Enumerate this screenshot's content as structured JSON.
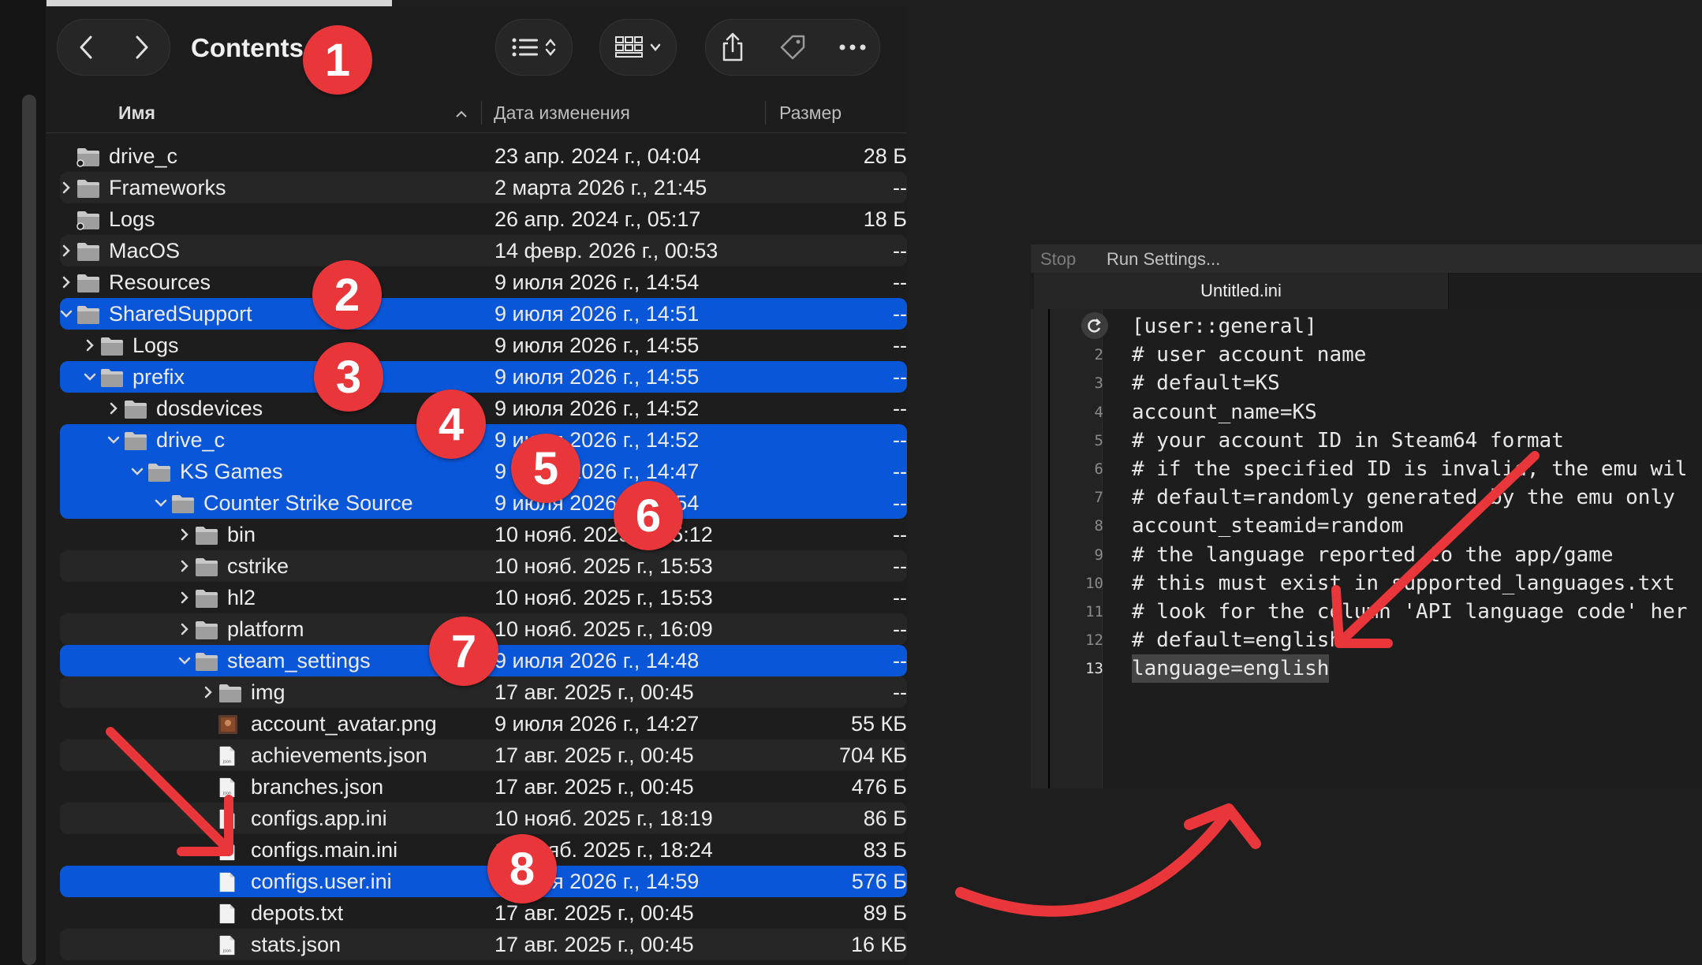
{
  "finder": {
    "title": "Contents",
    "columns": {
      "name": "Имя",
      "date": "Дата изменения",
      "size": "Размер"
    },
    "rows": [
      {
        "name": "drive_c",
        "date": "23 апр. 2024 г., 04:04",
        "size": "28 Б",
        "kind": "alias-folder",
        "depth": 0,
        "disclosure": "none",
        "selected": false
      },
      {
        "name": "Frameworks",
        "date": "2 марта 2026 г., 21:45",
        "size": "--",
        "kind": "folder",
        "depth": 0,
        "disclosure": "closed",
        "selected": false
      },
      {
        "name": "Logs",
        "date": "26 апр. 2024 г., 05:17",
        "size": "18 Б",
        "kind": "alias-folder",
        "depth": 0,
        "disclosure": "none",
        "selected": false
      },
      {
        "name": "MacOS",
        "date": "14 февр. 2026 г., 00:53",
        "size": "--",
        "kind": "folder",
        "depth": 0,
        "disclosure": "closed",
        "selected": false
      },
      {
        "name": "Resources",
        "date": "9 июля 2026 г., 14:54",
        "size": "--",
        "kind": "folder",
        "depth": 0,
        "disclosure": "closed",
        "selected": false
      },
      {
        "name": "SharedSupport",
        "date": "9 июля 2026 г., 14:51",
        "size": "--",
        "kind": "folder",
        "depth": 0,
        "disclosure": "open",
        "selected": true
      },
      {
        "name": "Logs",
        "date": "9 июля 2026 г., 14:55",
        "size": "--",
        "kind": "folder",
        "depth": 1,
        "disclosure": "closed",
        "selected": false
      },
      {
        "name": "prefix",
        "date": "9 июля 2026 г., 14:55",
        "size": "--",
        "kind": "folder",
        "depth": 1,
        "disclosure": "open",
        "selected": true
      },
      {
        "name": "dosdevices",
        "date": "9 июля 2026 г., 14:52",
        "size": "--",
        "kind": "folder",
        "depth": 2,
        "disclosure": "closed",
        "selected": false
      },
      {
        "name": "drive_c",
        "date": "9 июля 2026 г., 14:52",
        "size": "--",
        "kind": "folder",
        "depth": 2,
        "disclosure": "open",
        "selected": true
      },
      {
        "name": "KS Games",
        "date": "9 июля 2026 г., 14:47",
        "size": "--",
        "kind": "folder",
        "depth": 3,
        "disclosure": "open",
        "selected": true
      },
      {
        "name": "Counter Strike Source",
        "date": "9 июля 2026 г., 14:54",
        "size": "--",
        "kind": "folder",
        "depth": 4,
        "disclosure": "open",
        "selected": true
      },
      {
        "name": "bin",
        "date": "10 нояб. 2025 г., 15:12",
        "size": "--",
        "kind": "folder",
        "depth": 5,
        "disclosure": "closed",
        "selected": false
      },
      {
        "name": "cstrike",
        "date": "10 нояб. 2025 г., 15:53",
        "size": "--",
        "kind": "folder",
        "depth": 5,
        "disclosure": "closed",
        "selected": false
      },
      {
        "name": "hl2",
        "date": "10 нояб. 2025 г., 15:53",
        "size": "--",
        "kind": "folder",
        "depth": 5,
        "disclosure": "closed",
        "selected": false
      },
      {
        "name": "platform",
        "date": "10 нояб. 2025 г., 16:09",
        "size": "--",
        "kind": "folder",
        "depth": 5,
        "disclosure": "closed",
        "selected": false
      },
      {
        "name": "steam_settings",
        "date": "9 июля 2026 г., 14:48",
        "size": "--",
        "kind": "folder",
        "depth": 5,
        "disclosure": "open",
        "selected": true
      },
      {
        "name": "img",
        "date": "17 авг. 2025 г., 00:45",
        "size": "--",
        "kind": "folder",
        "depth": 6,
        "disclosure": "closed",
        "selected": false
      },
      {
        "name": "account_avatar.png",
        "date": "9 июля 2026 г., 14:27",
        "size": "55 КБ",
        "kind": "image",
        "depth": 6,
        "disclosure": "none",
        "selected": false
      },
      {
        "name": "achievements.json",
        "date": "17 авг. 2025 г., 00:45",
        "size": "704 КБ",
        "kind": "json",
        "depth": 6,
        "disclosure": "none",
        "selected": false
      },
      {
        "name": "branches.json",
        "date": "17 авг. 2025 г., 00:45",
        "size": "476 Б",
        "kind": "json",
        "depth": 6,
        "disclosure": "none",
        "selected": false
      },
      {
        "name": "configs.app.ini",
        "date": "10 нояб. 2025 г., 18:19",
        "size": "86 Б",
        "kind": "doc",
        "depth": 6,
        "disclosure": "none",
        "selected": false
      },
      {
        "name": "configs.main.ini",
        "date": "10 нояб. 2025 г., 18:24",
        "size": "83 Б",
        "kind": "doc",
        "depth": 6,
        "disclosure": "none",
        "selected": false
      },
      {
        "name": "configs.user.ini",
        "date": "9 июля 2026 г., 14:59",
        "size": "576 Б",
        "kind": "doc",
        "depth": 6,
        "disclosure": "none",
        "selected": true
      },
      {
        "name": "depots.txt",
        "date": "17 авг. 2025 г., 00:45",
        "size": "89 Б",
        "kind": "doc",
        "depth": 6,
        "disclosure": "none",
        "selected": false
      },
      {
        "name": "stats.json",
        "date": "17 авг. 2025 г., 00:45",
        "size": "16 КБ",
        "kind": "json",
        "depth": 6,
        "disclosure": "none",
        "selected": false
      }
    ]
  },
  "editor": {
    "toolbar": {
      "stop": "Stop",
      "run_settings": "Run Settings..."
    },
    "tab_title": "Untitled.ini",
    "lines": [
      {
        "n": "1",
        "text": "[user::general]"
      },
      {
        "n": "2",
        "text": "# user account name"
      },
      {
        "n": "3",
        "text": "# default=KS"
      },
      {
        "n": "4",
        "text": "account_name=KS"
      },
      {
        "n": "5",
        "text": "# your account ID in Steam64 format"
      },
      {
        "n": "6",
        "text": "# if the specified ID is invalid, the emu wil"
      },
      {
        "n": "7",
        "text": "# default=randomly generated by the emu only"
      },
      {
        "n": "8",
        "text": "account_steamid=random"
      },
      {
        "n": "9",
        "text": "# the language reported to the app/game"
      },
      {
        "n": "10",
        "text": "# this must exist in supported_languages.txt"
      },
      {
        "n": "11",
        "text": "# look for the column 'API language code' her"
      },
      {
        "n": "12",
        "text": "# default=english"
      },
      {
        "n": "13",
        "text": "language=english"
      }
    ],
    "current_line": "13"
  },
  "badges": [
    "1",
    "2",
    "3",
    "4",
    "5",
    "6",
    "7",
    "8"
  ],
  "colors": {
    "selection": "#0a56d8",
    "badge": "#e8363a",
    "arrow": "#e8363a",
    "background": "#1e1e1e"
  },
  "icons": [
    "chevron-left-icon",
    "chevron-right-icon",
    "list-view-icon",
    "group-grid-icon",
    "share-icon",
    "tag-icon",
    "more-icon",
    "folder-icon",
    "alias-folder-icon",
    "json-file-icon",
    "document-icon",
    "image-file-icon",
    "disclosure-chevron-icon",
    "sort-up-icon",
    "loop-icon"
  ]
}
